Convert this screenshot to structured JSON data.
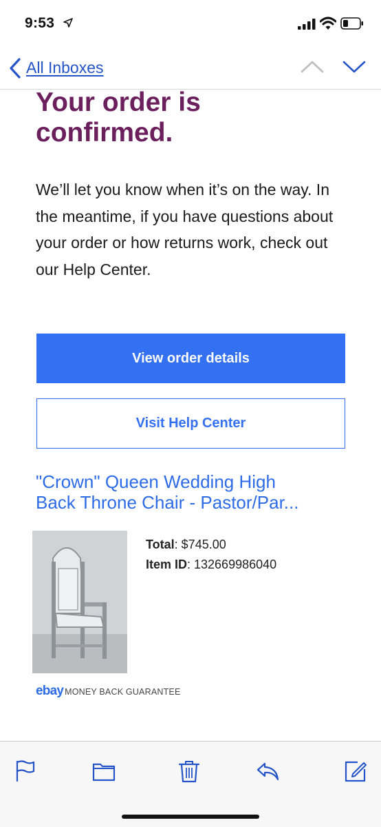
{
  "status_bar": {
    "time": "9:53",
    "icons": [
      "location-arrow-icon",
      "cellular-signal-icon",
      "wifi-icon",
      "battery-icon"
    ]
  },
  "nav": {
    "back_label": "All Inboxes",
    "icons": [
      "back-chevron-icon",
      "chevron-up-icon",
      "chevron-down-icon"
    ]
  },
  "email": {
    "headline_line1": "Your order is",
    "headline_line2": "confirmed.",
    "body": "We’ll let you know when it’s on the way. In the meantime, if you have questions about your order or how returns work, check out our Help Center.",
    "primary_button": "View order details",
    "secondary_button": "Visit Help Center",
    "item": {
      "title_line1": "\"Crown\" Queen Wedding High",
      "title_line2": "Back Throne Chair - Pastor/Par...",
      "total_label": "Total",
      "total_value": ": $745.00",
      "item_id_label": "Item ID",
      "item_id_value": ": 132669986040"
    },
    "guarantee": {
      "logo": "ebay",
      "text": "MONEY BACK GUARANTEE"
    }
  },
  "colors": {
    "headline": "#6b1f5c",
    "primary": "#3470f2",
    "link": "#2553c8",
    "item_title": "#2e6be6"
  },
  "toolbar": {
    "icons": [
      "flag-icon",
      "folder-icon",
      "trash-icon",
      "reply-icon",
      "compose-icon"
    ]
  }
}
